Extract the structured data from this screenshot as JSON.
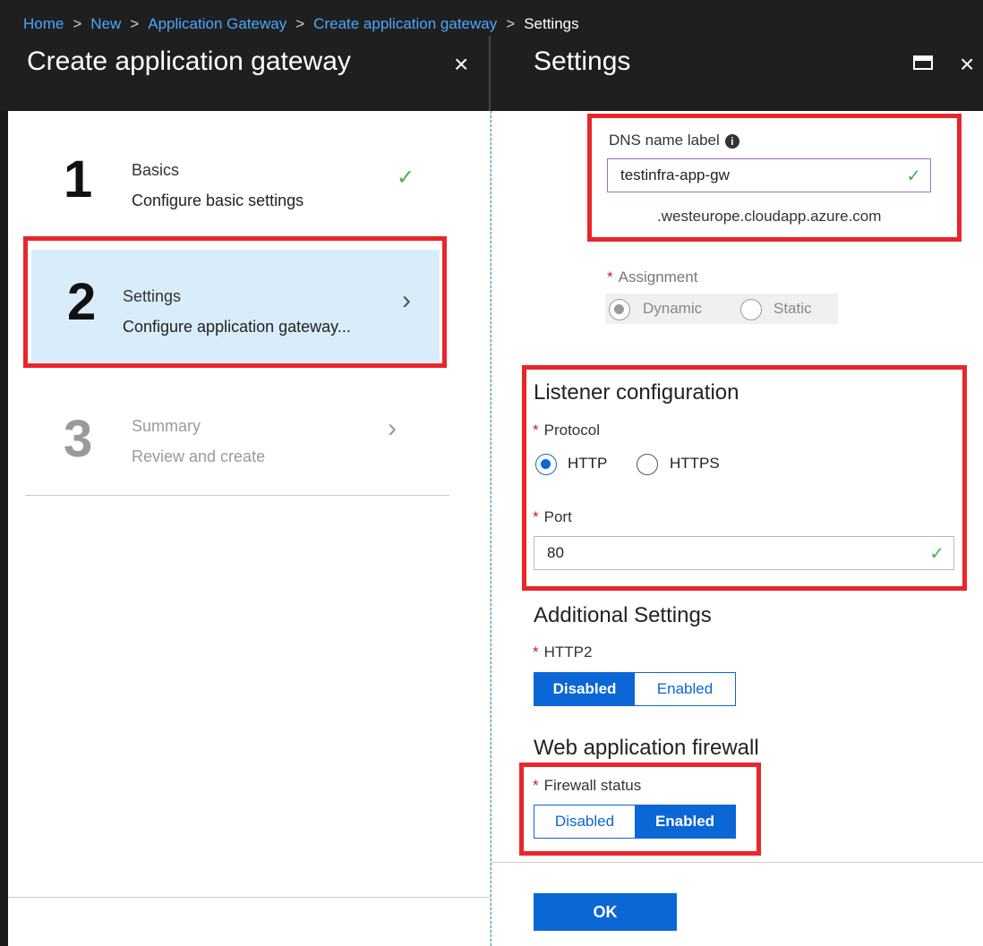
{
  "breadcrumb": {
    "items": [
      "Home",
      "New",
      "Application Gateway",
      "Create application gateway"
    ],
    "current": "Settings",
    "separator": ">"
  },
  "left_blade": {
    "title": "Create application gateway",
    "close_icon": "×",
    "steps": [
      {
        "number": "1",
        "title": "Basics",
        "subtitle": "Configure basic settings",
        "status_icon": "✓"
      },
      {
        "number": "2",
        "title": "Settings",
        "subtitle": "Configure application gateway...",
        "status_icon": "›"
      },
      {
        "number": "3",
        "title": "Summary",
        "subtitle": "Review and create",
        "status_icon": "›"
      }
    ]
  },
  "right_blade": {
    "title": "Settings",
    "close_icon": "×",
    "dns": {
      "label": "DNS name label",
      "info_icon": "i",
      "value": "testinfra-app-gw",
      "valid_icon": "✓",
      "suffix": ".westeurope.cloudapp.azure.com"
    },
    "assignment": {
      "label": "Assignment",
      "options": [
        "Dynamic",
        "Static"
      ],
      "selected": "Dynamic"
    },
    "listener": {
      "heading": "Listener configuration",
      "protocol_label": "Protocol",
      "protocol_options": [
        "HTTP",
        "HTTPS"
      ],
      "protocol_selected": "HTTP",
      "port_label": "Port",
      "port_value": "80",
      "port_valid_icon": "✓"
    },
    "additional": {
      "heading": "Additional Settings",
      "http2_label": "HTTP2",
      "http2_options": [
        "Disabled",
        "Enabled"
      ],
      "http2_selected": "Disabled"
    },
    "waf": {
      "heading": "Web application firewall",
      "firewall_label": "Firewall status",
      "firewall_options": [
        "Disabled",
        "Enabled"
      ],
      "firewall_selected": "Enabled"
    },
    "ok_label": "OK"
  },
  "required_marker": "*",
  "colors": {
    "accent": "#0b66d6",
    "highlight_box": "#e8262b",
    "valid": "#4bb04b",
    "topbar": "#1f1f1f",
    "selected_step": "#d9ecfa"
  }
}
